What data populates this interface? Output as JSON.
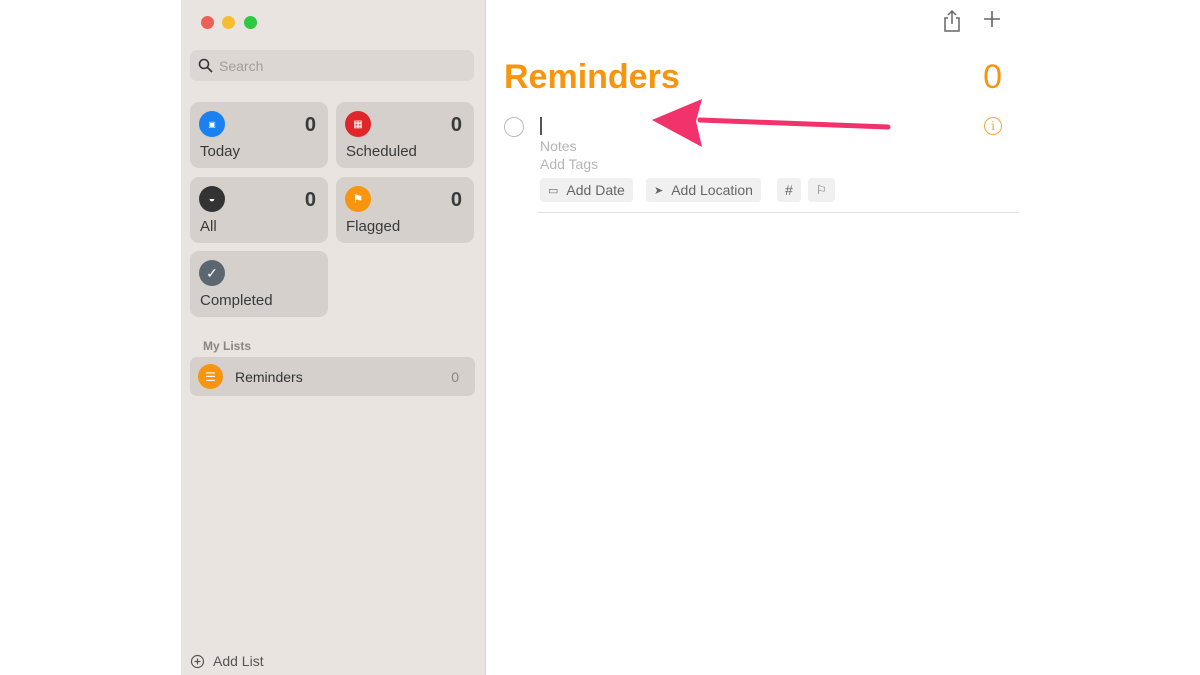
{
  "window": {
    "controls": [
      "close",
      "minimize",
      "zoom"
    ],
    "colors": {
      "close": "#ee5f57",
      "minimize": "#f5bd2f",
      "zoom": "#2fc840"
    }
  },
  "sidebar": {
    "search": {
      "placeholder": "Search"
    },
    "smart_lists": [
      {
        "label": "Today",
        "count": "0",
        "icon": "calendar-today-icon",
        "color": "#1a82f0"
      },
      {
        "label": "Scheduled",
        "count": "0",
        "icon": "calendar-icon",
        "color": "#e0252b"
      },
      {
        "label": "All",
        "count": "0",
        "icon": "tray-icon",
        "color": "#333333"
      },
      {
        "label": "Flagged",
        "count": "0",
        "icon": "flag-icon",
        "color": "#f7950f"
      },
      {
        "label": "Completed",
        "count": "",
        "icon": "checkmark-icon",
        "color": "#5b6670"
      }
    ],
    "my_lists_heading": "My Lists",
    "lists": [
      {
        "label": "Reminders",
        "count": "0",
        "icon": "list-icon",
        "color": "#f7950f"
      }
    ],
    "add_list": "Add List"
  },
  "main": {
    "title": "Reminders",
    "count": "0",
    "accent": "#f7950f",
    "new_item": {
      "notes_placeholder": "Notes",
      "tags_placeholder": "Add Tags",
      "chips": {
        "date": "Add Date",
        "location": "Add Location",
        "tag": "#"
      }
    },
    "annotation_arrow_color": "#f2326a"
  }
}
